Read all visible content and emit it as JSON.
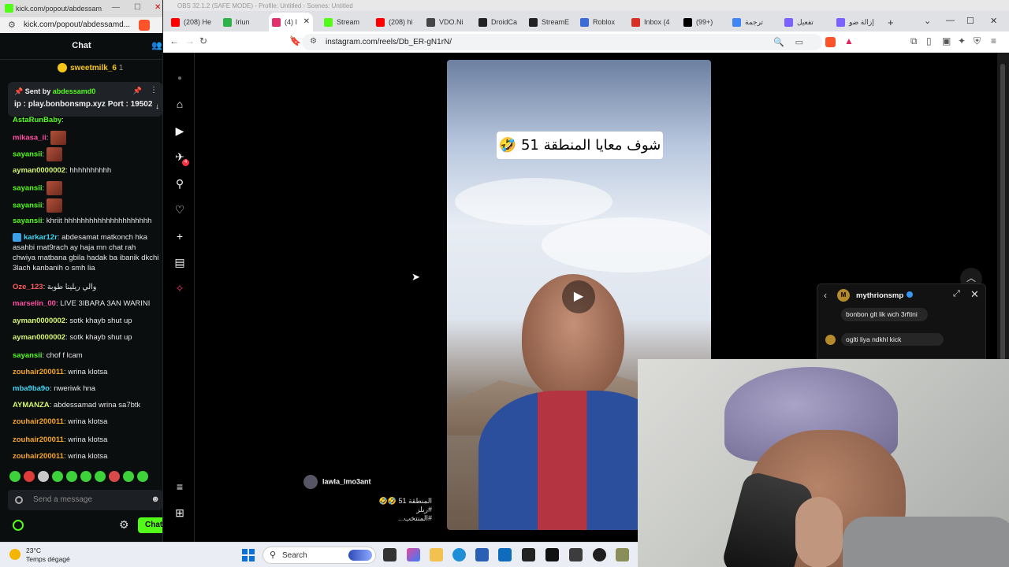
{
  "kick": {
    "window_title": "kick.com/popout/abdessam...",
    "url": "kick.com/popout/abdessamd...",
    "chat_title": "Chat",
    "gifter": {
      "name": "sweetmilk_6",
      "count": "1"
    },
    "pinned": {
      "sent_by_label": "Sent by",
      "sender": "abdessamd0",
      "text": "ip : play.bonbonsmp.xyz Port : 19502"
    },
    "messages": [
      {
        "user": "AstaRunBaby",
        "text": "",
        "color": "#53fc18",
        "emote": false
      },
      {
        "user": "mikasa_ii",
        "text": "",
        "color": "#ff4fa3",
        "emote": true
      },
      {
        "user": "sayansii",
        "text": "",
        "color": "#53fc18",
        "emote": true
      },
      {
        "user": "ayman0000002",
        "text": "hhhhhhhhhh",
        "color": "#d5f56b",
        "emote": false
      },
      {
        "user": "sayansii",
        "text": "",
        "color": "#53fc18",
        "emote": true
      },
      {
        "user": "sayansii",
        "text": "",
        "color": "#53fc18",
        "emote": true
      },
      {
        "user": "sayansii",
        "text": "khriit hhhhhhhhhhhhhhhhhhhhh",
        "color": "#53fc18",
        "emote": false
      },
      {
        "user": "karkar12r",
        "text": "abdesamat matkonch hka asahbi mat9rach ay haja mn chat rah chwiya matbana gbila hadak ba ibanik dkchi 3lach kanbanih o smh lia",
        "color": "#3ad8f5",
        "emote": false
      },
      {
        "user": "Oze_123",
        "text": "والي ريلينا طوبة",
        "color": "#ff5b5b",
        "emote": false
      },
      {
        "user": "marselin_00",
        "text": "LIVE 3IBARA 3AN WARINI",
        "color": "#ff4fa3",
        "emote": false
      },
      {
        "user": "ayman0000002",
        "text": "sotk khayb shut up",
        "color": "#d5f56b",
        "emote": false
      },
      {
        "user": "ayman0000002",
        "text": "sotk khayb shut up",
        "color": "#d5f56b",
        "emote": false
      },
      {
        "user": "sayansii",
        "text": "chof f lcam",
        "color": "#53fc18",
        "emote": false
      },
      {
        "user": "zouhair200011",
        "text": "wrina klotsa",
        "color": "#f5a623",
        "emote": false
      },
      {
        "user": "mba9ba9o",
        "text": "nweriwk hna",
        "color": "#3ad8f5",
        "emote": false
      },
      {
        "user": "AYMANZA",
        "text": "abdessamad wrina sa7btk",
        "color": "#d5f56b",
        "emote": false
      },
      {
        "user": "zouhair200011",
        "text": "wrina klotsa",
        "color": "#f5a623",
        "emote": false
      },
      {
        "user": "zouhair200011",
        "text": "wrina klotsa",
        "color": "#f5a623",
        "emote": false
      },
      {
        "user": "zouhair200011",
        "text": "wrina klotsa",
        "color": "#f5a623",
        "emote": false
      }
    ],
    "input_placeholder": "Send a message",
    "chat_button": "Chat"
  },
  "browser": {
    "obs_title": "OBS 32.1.2 (SAFE MODE) - Profile: Untitled - Scenes: Untitled",
    "tabs": [
      {
        "label": "(208) He",
        "color": "#ff0000"
      },
      {
        "label": "Iriun",
        "color": "#2db34a"
      },
      {
        "label": "(4) I",
        "color": "#e1306c",
        "active": true
      },
      {
        "label": "Stream",
        "color": "#53fc18"
      },
      {
        "label": "(208) hi",
        "color": "#ff0000"
      },
      {
        "label": "VDO.Ni",
        "color": "#444444"
      },
      {
        "label": "DroidCa",
        "color": "#222222"
      },
      {
        "label": "StreamE",
        "color": "#222222"
      },
      {
        "label": "Roblox",
        "color": "#3b6bd6"
      },
      {
        "label": "Inbox (4",
        "color": "#d93025"
      },
      {
        "label": "(99+)",
        "color": "#000000"
      },
      {
        "label": "ترجمة",
        "color": "#4285f4"
      },
      {
        "label": "تفعيل",
        "color": "#7b61ff"
      },
      {
        "label": "إزالة ضو",
        "color": "#7b61ff"
      }
    ],
    "url": "instagram.com/reels/Db_ER-gN1rN/"
  },
  "instagram": {
    "reel_caption": "شوف معايا المنطقة 51 🤣",
    "username": "lawla_lmo3ant",
    "description_lines": [
      "المنطقة 51 🤣🤣",
      "#ريلز",
      "#المنتخب..."
    ],
    "notification_count": "4"
  },
  "dm": {
    "user": "mythrionsmp",
    "messages": [
      "bonbon glt lik wch 3rftini",
      "oglti liya ndkhl kick"
    ]
  },
  "taskbar": {
    "temperature": "23°C",
    "weather": "Temps dégagé",
    "search": "Search"
  }
}
